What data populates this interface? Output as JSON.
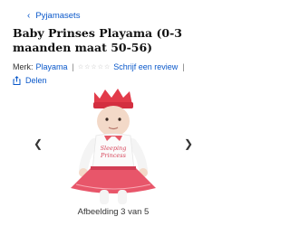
{
  "breadcrumb": {
    "label": "Pyjamasets"
  },
  "product": {
    "title": "Baby Prinses Playama (0-3 maanden maat 50-56)",
    "brand_label": "Merk:",
    "brand_name": "Playama",
    "separator": "|",
    "rating_stars": 5,
    "review_link": "Schrijf een review",
    "share_label": "Delen",
    "image_text": "Sleeping Princess"
  },
  "gallery": {
    "caption": "Afbeelding 3 van 5",
    "current": 3,
    "total": 5
  },
  "icons": {
    "back": "chevron-left-icon",
    "share": "share-icon",
    "prev": "chevron-left-icon",
    "next": "chevron-right-icon"
  },
  "colors": {
    "link": "#0a58ca",
    "crown": "#e23b4a",
    "skirt": "#e8566a"
  }
}
